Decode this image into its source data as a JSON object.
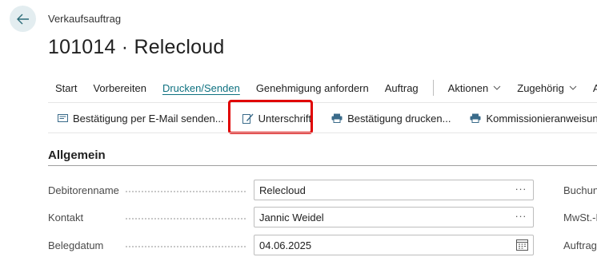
{
  "header": {
    "caption": "Verkaufsauftrag",
    "title": "101014 · Relecloud"
  },
  "actions": [
    {
      "label": "Start"
    },
    {
      "label": "Vorbereiten"
    },
    {
      "label": "Drucken/Senden",
      "active": true
    },
    {
      "label": "Genehmigung anfordern"
    },
    {
      "label": "Auftrag"
    },
    {
      "label": "Aktionen",
      "dropdown": true
    },
    {
      "label": "Zugehörig",
      "dropdown": true
    },
    {
      "label": "Au"
    }
  ],
  "subactions": {
    "email": "Bestätigung per E-Mail senden...",
    "signature": "Unterschrift",
    "print_confirmation": "Bestätigung drucken...",
    "picking": "Kommissionieranweisung"
  },
  "section": {
    "title": "Allgemein"
  },
  "fields": {
    "customer_name_label": "Debitorenname",
    "customer_name_value": "Relecloud",
    "contact_label": "Kontakt",
    "contact_value": "Jannic Weidel",
    "doc_date_label": "Belegdatum",
    "doc_date_value": "04.06.2025",
    "more_glyph": "···"
  },
  "right_fields": {
    "label1": "Buchung",
    "label2": "MwSt.-D",
    "label3": "Auftrag"
  },
  "colors": {
    "accent": "#0e7180",
    "highlight": "#e00000",
    "back_bg": "#e3edf0"
  }
}
